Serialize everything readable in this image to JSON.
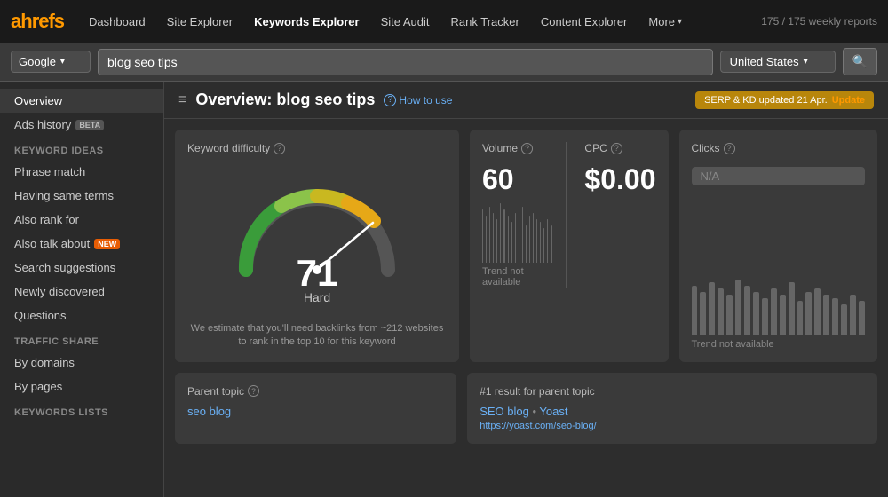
{
  "logo": {
    "text_a": "a",
    "text_hrefs": "hrefs"
  },
  "nav": {
    "items": [
      {
        "label": "Dashboard",
        "active": false
      },
      {
        "label": "Site Explorer",
        "active": false
      },
      {
        "label": "Keywords Explorer",
        "active": true
      },
      {
        "label": "Site Audit",
        "active": false
      },
      {
        "label": "Rank Tracker",
        "active": false
      },
      {
        "label": "Content Explorer",
        "active": false
      }
    ],
    "more_label": "More",
    "weekly_reports": "175 / 175 weekly reports"
  },
  "search_bar": {
    "engine": "Google",
    "query": "blog seo tips",
    "country": "United States",
    "search_icon": "🔍"
  },
  "sidebar": {
    "overview_label": "Overview",
    "ads_history_label": "Ads history",
    "ads_history_badge": "BETA",
    "keyword_ideas_section": "Keyword ideas",
    "items_keyword": [
      {
        "label": "Phrase match",
        "badge": null
      },
      {
        "label": "Having same terms",
        "badge": null
      },
      {
        "label": "Also rank for",
        "badge": null
      },
      {
        "label": "Also talk about",
        "badge": "NEW"
      },
      {
        "label": "Search suggestions",
        "badge": null
      },
      {
        "label": "Newly discovered",
        "badge": null
      },
      {
        "label": "Questions",
        "badge": null
      }
    ],
    "traffic_share_section": "Traffic share",
    "items_traffic": [
      {
        "label": "By domains",
        "badge": null
      },
      {
        "label": "By pages",
        "badge": null
      }
    ],
    "keywords_lists_section": "Keywords lists"
  },
  "page_header": {
    "title": "Overview: blog seo tips",
    "how_to_use": "How to use",
    "serp_badge": "SERP & KD updated 21 Apr.",
    "update_label": "Update"
  },
  "keyword_difficulty": {
    "title": "Keyword difficulty",
    "value": "71",
    "label": "Hard",
    "note": "We estimate that you'll need backlinks from ~212 websites to rank in the top 10 for this keyword"
  },
  "volume": {
    "title": "Volume",
    "value": "60",
    "trend_not_available": "Trend not available",
    "bars": [
      85,
      75,
      90,
      80,
      70,
      95,
      85,
      75,
      65,
      80,
      70,
      90,
      60,
      75,
      80,
      70,
      65,
      55,
      70,
      60
    ]
  },
  "cpc": {
    "title": "CPC",
    "value": "$0.00"
  },
  "clicks": {
    "title": "Clicks",
    "value": "N/A",
    "trend_not_available": "Trend not available",
    "bars": [
      80,
      70,
      85,
      75,
      65,
      90,
      80,
      70,
      60,
      75,
      65,
      85,
      55,
      70,
      75,
      65,
      60,
      50,
      65,
      55
    ]
  },
  "parent_topic": {
    "title": "Parent topic",
    "value": "seo blog"
  },
  "number_one_result": {
    "title": "#1 result for parent topic",
    "site_name": "SEO blog",
    "site_author": "Yoast",
    "url": "https://yoast.com/seo-blog/"
  }
}
